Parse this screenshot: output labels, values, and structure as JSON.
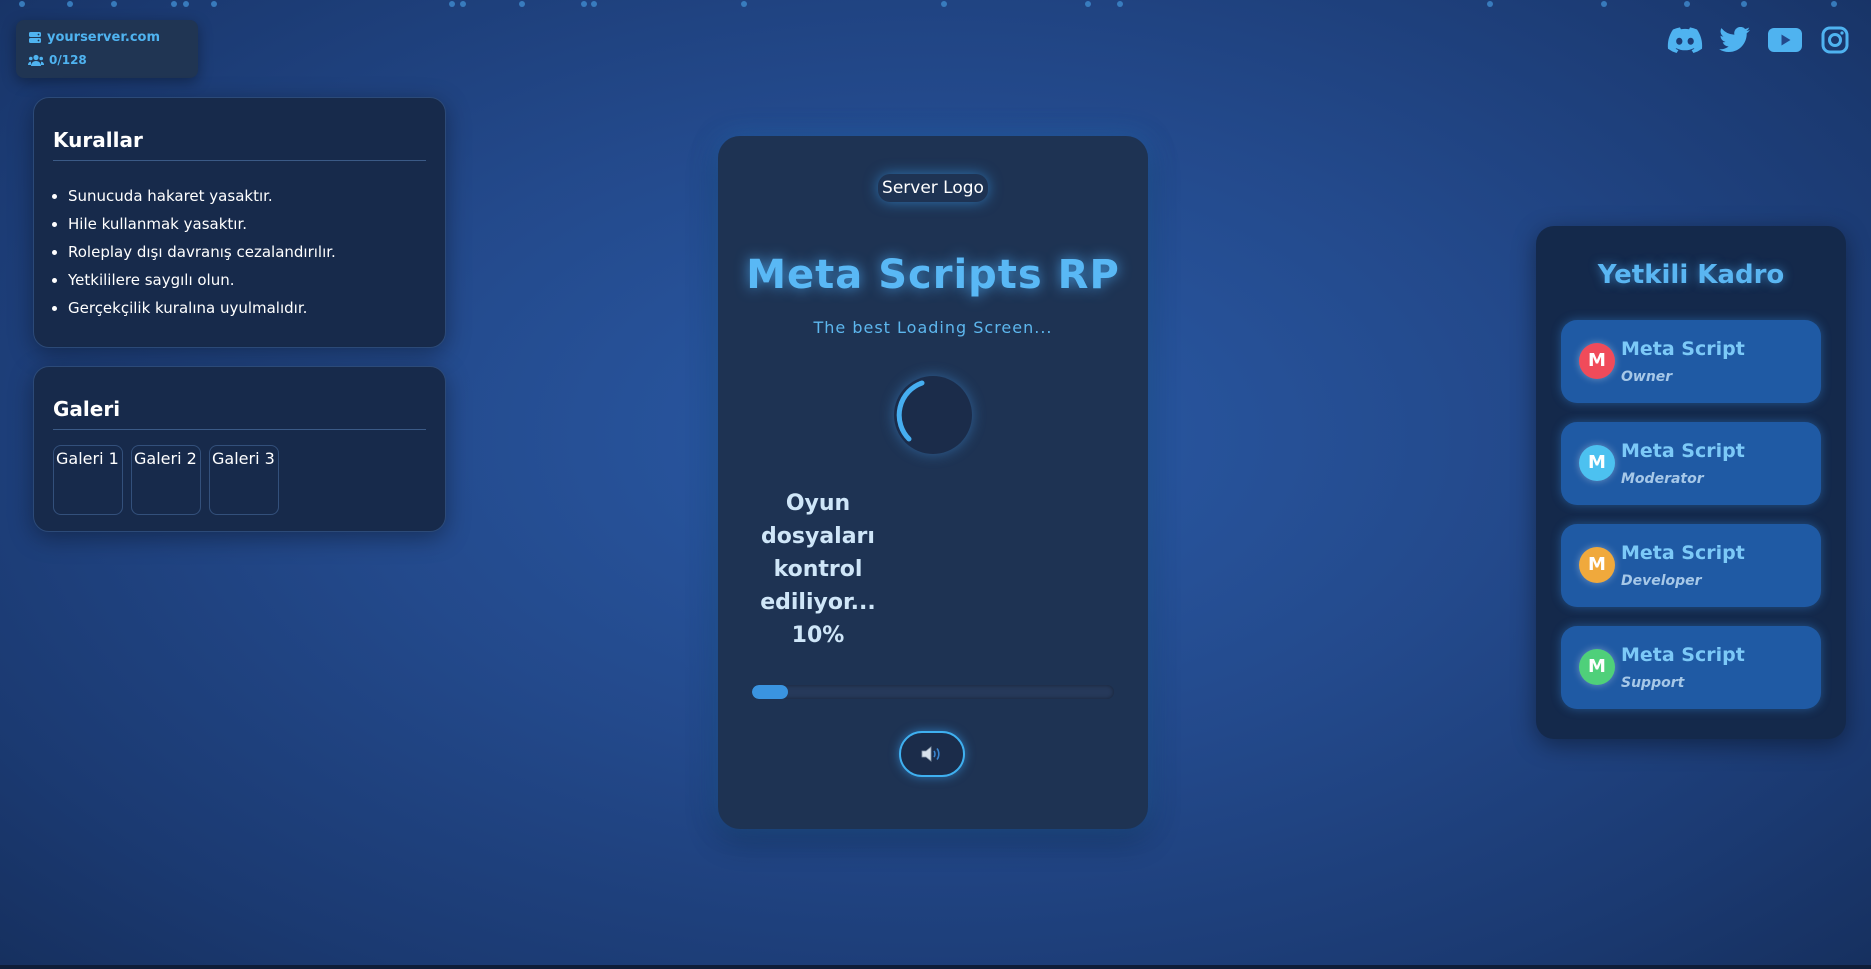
{
  "server": {
    "address": "yourserver.com",
    "players": "0/128"
  },
  "socials": [
    {
      "name": "discord",
      "icon": "discord-icon"
    },
    {
      "name": "twitter",
      "icon": "twitter-icon"
    },
    {
      "name": "youtube",
      "icon": "youtube-icon"
    },
    {
      "name": "instagram",
      "icon": "instagram-icon"
    }
  ],
  "rules": {
    "title": "Kurallar",
    "items": [
      "Sunucuda hakaret yasaktır.",
      "Hile kullanmak yasaktır.",
      "Roleplay dışı davranış cezalandırılır.",
      "Yetkililere saygılı olun.",
      "Gerçekçilik kuralına uyulmalıdır."
    ]
  },
  "gallery": {
    "title": "Galeri",
    "images": [
      "Galeri 1",
      "Galeri 2",
      "Galeri 3"
    ]
  },
  "loading": {
    "logo_alt": "Server Logo",
    "title": "Meta Scripts RP",
    "subtitle": "The best Loading Screen...",
    "status": "Oyun dosyaları kontrol ediliyor... 10%",
    "progress_percent": 10,
    "sound_icon": "speaker-icon"
  },
  "staff": {
    "title": "Yetkili Kadro",
    "members": [
      {
        "initial": "M",
        "name": "Meta Script",
        "role": "Owner",
        "color": "#f04b5a"
      },
      {
        "initial": "M",
        "name": "Meta Script",
        "role": "Moderator",
        "color": "#4cc1f0"
      },
      {
        "initial": "M",
        "name": "Meta Script",
        "role": "Developer",
        "color": "#f0a93c"
      },
      {
        "initial": "M",
        "name": "Meta Script",
        "role": "Support",
        "color": "#4fd07a"
      }
    ]
  },
  "colors": {
    "accent": "#59b8f5",
    "progress": "#3a94e0"
  }
}
